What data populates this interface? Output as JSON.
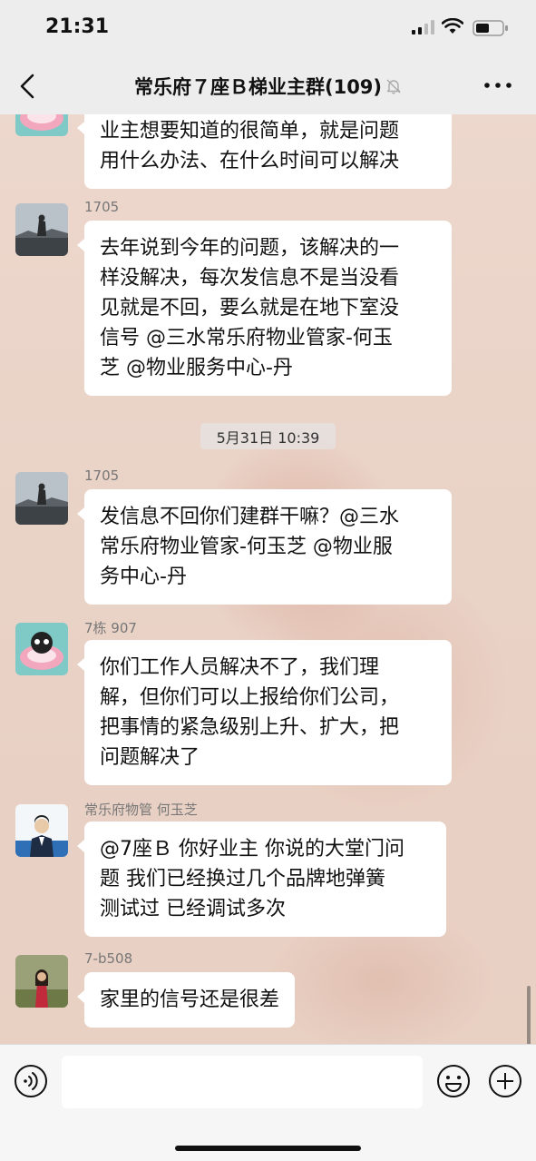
{
  "status_bar": {
    "time": "21:31",
    "icons": [
      "signal-icon",
      "wifi-icon",
      "battery-icon"
    ]
  },
  "header": {
    "title": "常乐府７座Ｂ梯业主群(109)",
    "back_icon": "chevron-left-icon",
    "mute_icon": "bell-off-icon",
    "more_icon": "more-dots-icon"
  },
  "messages": [
    {
      "sender": "",
      "text": "业主想要知道的很简单，就是问题\n用什么办法、在什么时间可以解决",
      "avatar": "cartoon-avatar"
    },
    {
      "sender": "1705",
      "text": "去年说到今年的问题，该解决的一\n样没解决，每次发信息不是当没看\n见就是不回，要么就是在地下室没\n信号 @三水常乐府物业管家-何玉\n芝 @物业服务中心-丹",
      "avatar": "photo-avatar"
    },
    {
      "sender": "1705",
      "text": "发信息不回你们建群干嘛？@三水\n常乐府物业管家-何玉芝 @物业服\n务中心-丹",
      "avatar": "photo-avatar"
    },
    {
      "sender": "7栋 907",
      "text": "你们工作人员解决不了，我们理\n解，但你们可以上报给你们公司，\n把事情的紧急级别上升、扩大，把\n问题解决了",
      "avatar": "cartoon-avatar"
    },
    {
      "sender": "常乐府物管 何玉芝",
      "text": "@7座Ｂ 你好业主 你说的大堂门问\n题 我们已经换过几个品牌地弹簧\n测试过 已经调试多次",
      "avatar": "staff-avatar"
    },
    {
      "sender": "7-b508",
      "text": "家里的信号还是很差",
      "avatar": "person-avatar"
    }
  ],
  "timestamp": "5月31日 10:39",
  "input_bar": {
    "voice_icon": "voice-icon",
    "emoji_icon": "emoji-icon",
    "add_icon": "plus-circle-icon",
    "input_value": ""
  },
  "colors": {
    "bubble": "#ffffff",
    "bar": "#ededed",
    "sender_text": "#777777"
  }
}
